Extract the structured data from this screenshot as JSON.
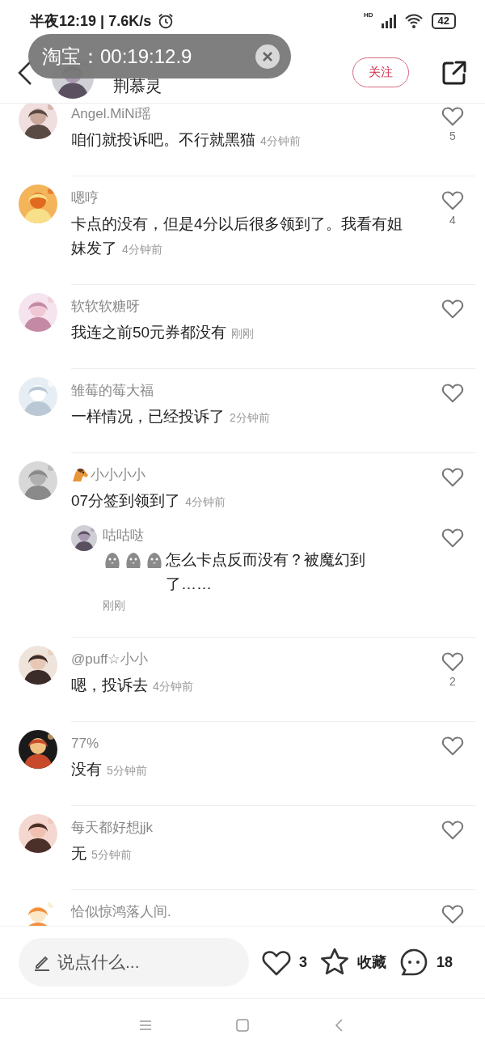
{
  "status_bar": {
    "time": "半夜12:19",
    "separator": "|",
    "speed": "7.6K/s",
    "network": "HD",
    "battery": "42"
  },
  "overlay": {
    "label": "淘宝：00:19:12.9"
  },
  "header": {
    "name": "荆慕灵",
    "follow": "关注"
  },
  "comments": [
    {
      "name": "Angel.MiNi瑶",
      "text": "咱们就投诉吧。不行就黑猫",
      "time": "4分钟前",
      "likes": "5"
    },
    {
      "name": "嗯哼",
      "text": "卡点的没有，但是4分以后很多领到了。我看有姐妹发了",
      "time": "4分钟前",
      "likes": "4"
    },
    {
      "name": "软软软糖呀",
      "text": "我连之前50元券都没有",
      "time": "刚刚"
    },
    {
      "name": "雏莓的莓大福",
      "text": "一样情况，已经投诉了",
      "time": "2分钟前"
    },
    {
      "name": "小小小小",
      "name_icons": [
        {
          "kind": "horse"
        }
      ],
      "text": "07分签到领到了",
      "time": "4分钟前",
      "replies": [
        {
          "name": "咕咕哒",
          "stickers": [
            {
              "kind": "sticker"
            },
            {
              "kind": "sticker"
            },
            {
              "kind": "sticker"
            }
          ],
          "text": "怎么卡点反而没有？被魔幻到了……",
          "time": "刚刚"
        }
      ]
    },
    {
      "name": "@puff☆小小",
      "text": "嗯，投诉去",
      "time": "4分钟前",
      "likes": "2"
    },
    {
      "name": "77%",
      "text": "没有",
      "time": "5分钟前"
    },
    {
      "name": "每天都好想jjk",
      "text": "无",
      "time": "5分钟前"
    },
    {
      "name": "恰似惊鸿落人间."
    }
  ],
  "bottom_bar": {
    "placeholder": "说点什么...",
    "likes": "3",
    "favorite": "收藏",
    "comments": "18"
  }
}
